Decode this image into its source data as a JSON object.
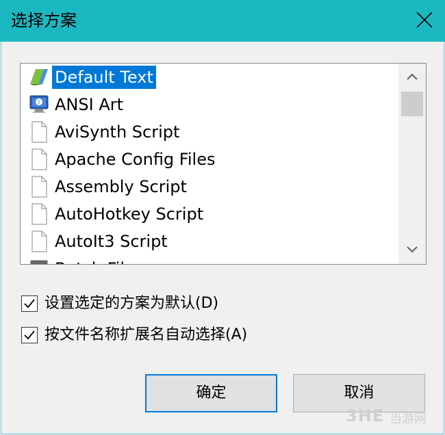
{
  "window": {
    "title": "选择方案"
  },
  "list": {
    "items": [
      {
        "label": "Default Text",
        "icon": "default-text-icon",
        "selected": true
      },
      {
        "label": "ANSI Art",
        "icon": "ansi-art-icon",
        "selected": false
      },
      {
        "label": "AviSynth Script",
        "icon": "file-icon",
        "selected": false
      },
      {
        "label": "Apache Config Files",
        "icon": "file-icon",
        "selected": false
      },
      {
        "label": "Assembly Script",
        "icon": "file-icon",
        "selected": false
      },
      {
        "label": "AutoHotkey Script",
        "icon": "file-icon",
        "selected": false
      },
      {
        "label": "AutoIt3 Script",
        "icon": "file-icon",
        "selected": false
      },
      {
        "label": "Batch Files",
        "icon": "batch-file-icon",
        "selected": false
      }
    ]
  },
  "options": {
    "set_default": {
      "label": "设置选定的方案为默认(D)",
      "checked": true
    },
    "auto_select": {
      "label": "按文件名称扩展名自动选择(A)",
      "checked": true
    }
  },
  "buttons": {
    "ok": "确定",
    "cancel": "取消"
  },
  "watermark": {
    "logo": "3HE",
    "text": "当游网"
  },
  "colors": {
    "titlebar": "#1cb8c2",
    "selection": "#0078d7",
    "button_border_focus": "#0078d7"
  }
}
